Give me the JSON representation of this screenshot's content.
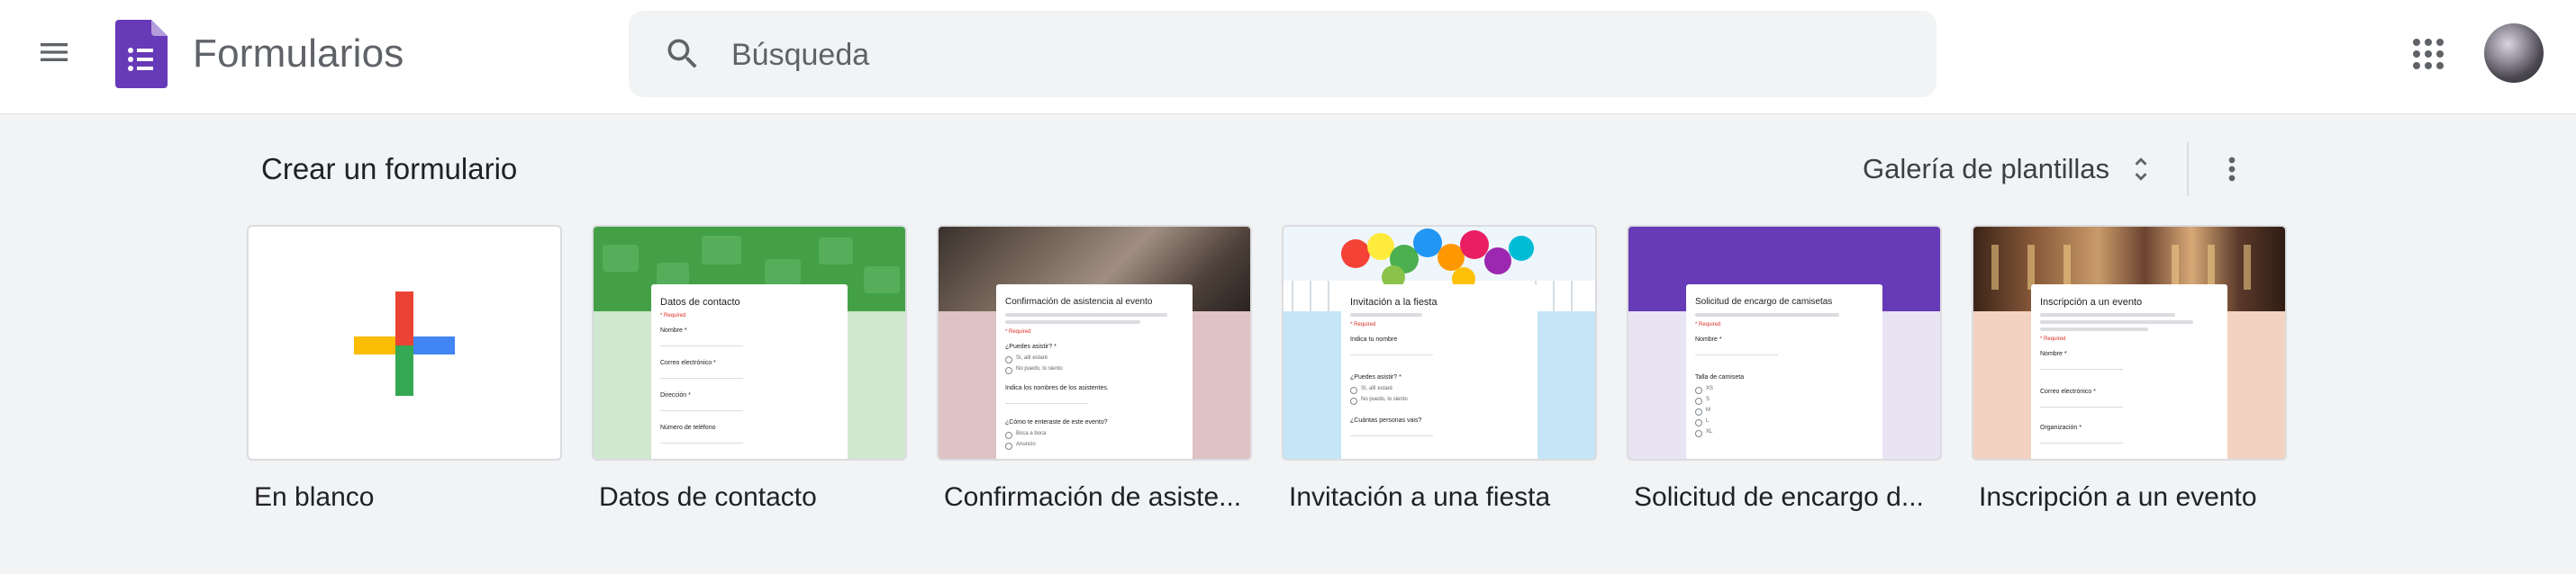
{
  "app": {
    "title": "Formularios",
    "brand_color": "#673ab7"
  },
  "search": {
    "placeholder": "Búsqueda",
    "value": ""
  },
  "icons": {
    "menu": "hamburger-menu-icon",
    "search": "magnifier-icon",
    "apps": "google-apps-grid-icon",
    "sort": "unfold-more-icon",
    "more": "more-vert-icon"
  },
  "section": {
    "title": "Crear un formulario",
    "gallery_label": "Galería de plantillas"
  },
  "templates": [
    {
      "label": "En blanco",
      "theme": "#ffffff"
    },
    {
      "label": "Datos de contacto",
      "theme": "#d0e8cf",
      "header": "#43a047",
      "form_title": "Datos de contacto",
      "req": "* Required",
      "questions": [
        "Nombre *",
        "Correo electrónico *",
        "Dirección *",
        "Número de teléfono"
      ]
    },
    {
      "label": "Confirmación de asiste...",
      "theme": "#dfc2c3",
      "header": "#6d5a52",
      "form_title": "Confirmación de asistencia al evento",
      "req": "* Required",
      "questions": [
        "¿Puedes asistir? *",
        "Indica los nombres de los asistentes.",
        "¿Cómo te enteraste de este evento?"
      ],
      "options": [
        "Sí, allí estaré",
        "No puedo, lo siento",
        "Boca a boca",
        "Anuncio"
      ]
    },
    {
      "label": "Invitación a una fiesta",
      "theme": "#c5e6f7",
      "header": "#e8f4fb",
      "form_title": "Invitación a la fiesta",
      "req": "* Required",
      "questions": [
        "Indica tu nombre",
        "¿Puedes asistir? *",
        "¿Cuántas personas vais?"
      ],
      "options": [
        "Sí, allí estaré",
        "No puedo, lo siento"
      ]
    },
    {
      "label": "Solicitud de encargo d...",
      "theme": "#e9e4f3",
      "header": "#673ab7",
      "form_title": "Solicitud de encargo de camisetas",
      "req": "* Required",
      "questions": [
        "Nombre *",
        "Talla de camiseta"
      ],
      "options": [
        "XS",
        "S",
        "M",
        "L",
        "XL"
      ]
    },
    {
      "label": "Inscripción a un evento",
      "theme": "#f4d2c1",
      "header": "#5b3a2a",
      "form_title": "Inscripción a un evento",
      "req": "* Required",
      "questions": [
        "Nombre *",
        "Correo electrónico *",
        "Organización *"
      ]
    }
  ]
}
